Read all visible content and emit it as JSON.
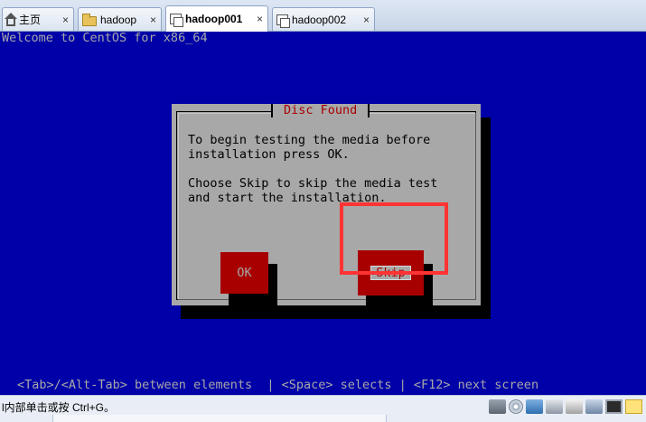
{
  "tabs": [
    {
      "label": "主页",
      "icon": "home-icon",
      "active": false
    },
    {
      "label": "hadoop",
      "icon": "folder-icon",
      "active": false
    },
    {
      "label": "hadoop001",
      "icon": "vm-icon",
      "active": true
    },
    {
      "label": "hadoop002",
      "icon": "vm-icon",
      "active": false
    }
  ],
  "tab_close_glyph": "×",
  "console": {
    "welcome": "Welcome to CentOS for x86_64",
    "dialog": {
      "title": "Disc Found",
      "text": "To begin testing the media before\ninstallation press OK.\n\nChoose Skip to skip the media test\nand start the installation.",
      "ok_label": "OK",
      "skip_label": "Skip"
    },
    "hint": "<Tab>/<Alt-Tab> between elements  | <Space> selects | <F12> next screen"
  },
  "statusbar": {
    "text": "l内部单击或按 Ctrl+G。",
    "tray_icons": [
      "disk-icon",
      "cd-icon",
      "network-icon",
      "usb-icon",
      "printer-icon",
      "sound-icon",
      "monitor-icon",
      "message-icon"
    ]
  },
  "colors": {
    "console_bg": "#0000a8",
    "dialog_bg": "#a8a8a8",
    "title_red": "#a80000",
    "button_red": "#a80000",
    "annotation_red": "#ff3333"
  }
}
